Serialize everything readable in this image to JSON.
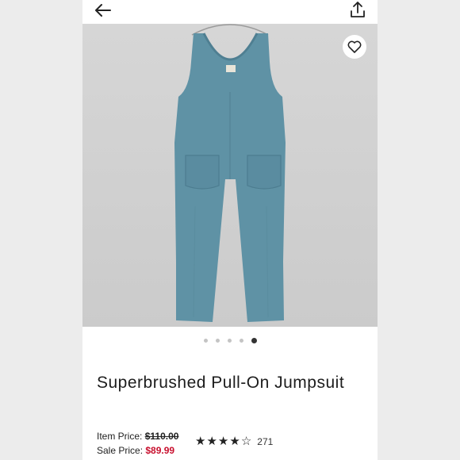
{
  "header": {
    "back_icon": "back-arrow-icon",
    "share_icon": "share-icon"
  },
  "product": {
    "title": "Superbrushed Pull-On Jumpsuit",
    "image_alt": "Blue sleeveless wide-leg jumpsuit with front patch pockets on a hanger",
    "favorite_icon": "heart-icon",
    "carousel": {
      "count": 5,
      "active_index": 4
    },
    "item_price_label": "Item Price:",
    "item_price": "$110.00",
    "sale_price_label": "Sale Price:",
    "sale_price": "$89.99",
    "rating": {
      "stars": 4,
      "max": 5,
      "count": "271"
    }
  },
  "colors": {
    "garment": "#5f92a5",
    "sale": "#c8102e"
  }
}
